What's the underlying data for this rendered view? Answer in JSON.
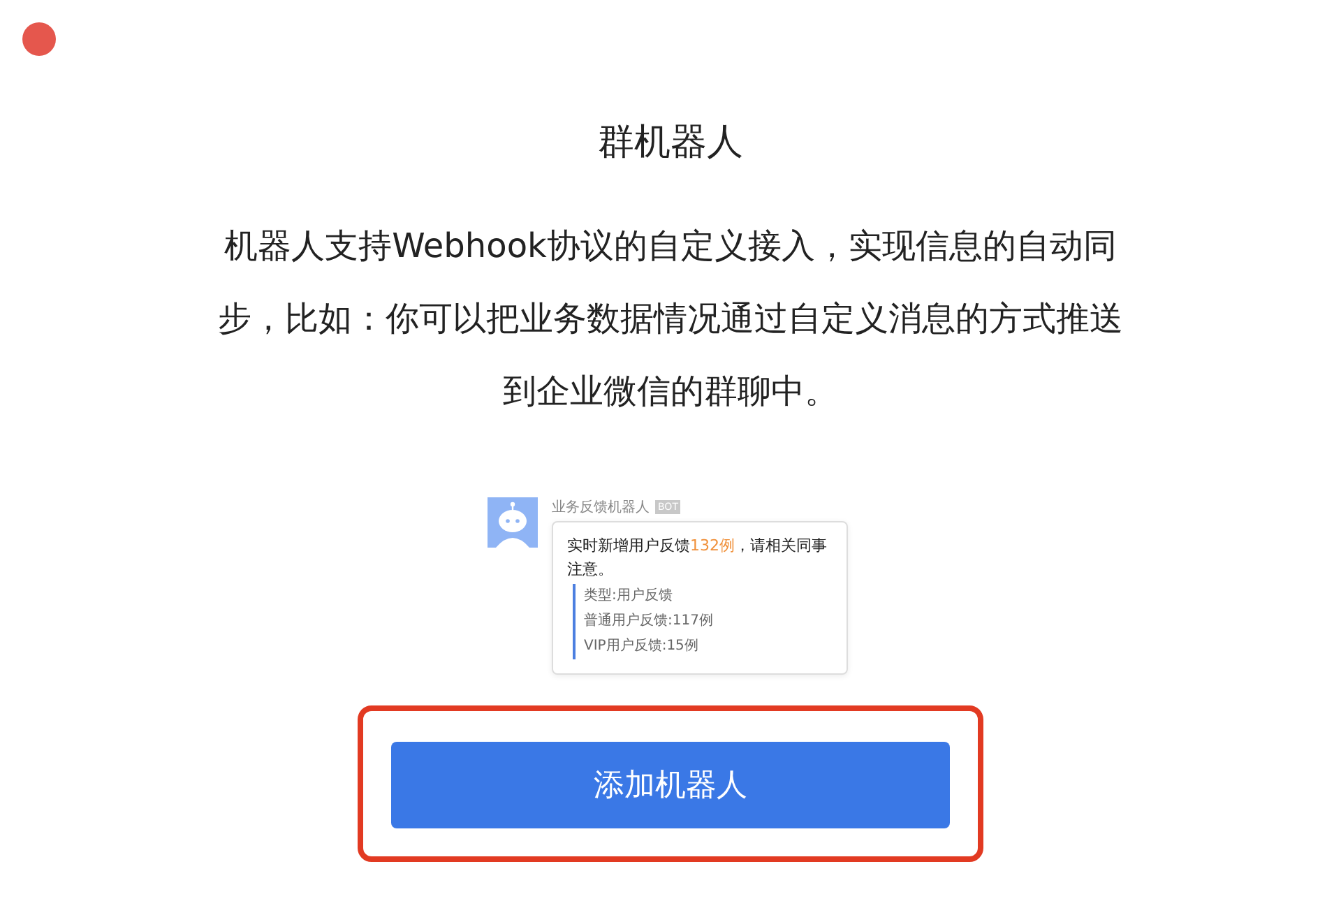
{
  "window": {
    "close_button": true
  },
  "title": "群机器人",
  "description": "机器人支持Webhook协议的自定义接入，实现信息的自动同步，比如：你可以把业务数据情况通过自定义消息的方式推送到企业微信的群聊中。",
  "preview": {
    "sender": "业务反馈机器人",
    "badge": "BOT",
    "message_start": "实时新增用户反馈",
    "message_highlight": "132例",
    "message_end": "，请相关同事注意。",
    "quote_lines": [
      "类型:用户反馈",
      "普通用户反馈:117例",
      "VIP用户反馈:15例"
    ]
  },
  "button": {
    "label": "添加机器人",
    "highlighted": true
  }
}
